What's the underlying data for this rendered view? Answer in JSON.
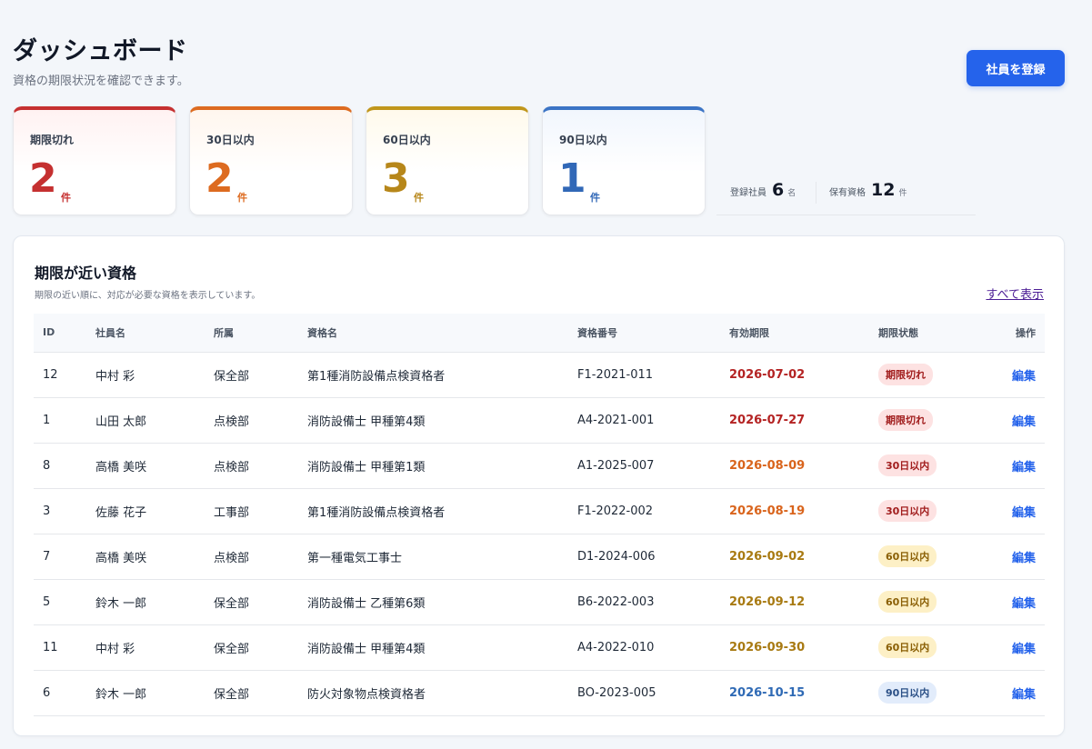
{
  "header": {
    "title": "ダッシュボード",
    "subtitle": "資格の期限状況を確認できます。",
    "register_button": "社員を登録"
  },
  "summary_cards": [
    {
      "label": "期限切れ",
      "value": "2",
      "unit": "件",
      "color": "#c53030"
    },
    {
      "label": "30日以内",
      "value": "2",
      "unit": "件",
      "color": "#dd6b20"
    },
    {
      "label": "60日以内",
      "value": "3",
      "unit": "件",
      "color": "#c0961b"
    },
    {
      "label": "90日以内",
      "value": "1",
      "unit": "件",
      "color": "#3b74c5"
    }
  ],
  "stats": {
    "employees": {
      "label": "登録社員",
      "value": "6",
      "unit": "名"
    },
    "qualifications": {
      "label": "保有資格",
      "value": "12",
      "unit": "件"
    }
  },
  "panel": {
    "title": "期限が近い資格",
    "description": "期限の近い順に、対応が必要な資格を表示しています。",
    "view_all": "すべて表示"
  },
  "table": {
    "columns": [
      "ID",
      "社員名",
      "所属",
      "資格名",
      "資格番号",
      "有効期限",
      "期限状態",
      "操作"
    ],
    "rows": [
      {
        "id": "12",
        "name": "中村 彩",
        "dept": "保全部",
        "qual": "第1種消防設備点検資格者",
        "number": "F1-2021-011",
        "expiry": "2026-07-02",
        "status": "期限切れ",
        "level": "expired",
        "action": "編集"
      },
      {
        "id": "1",
        "name": "山田 太郎",
        "dept": "点検部",
        "qual": "消防設備士 甲種第4類",
        "number": "A4-2021-001",
        "expiry": "2026-07-27",
        "status": "期限切れ",
        "level": "expired",
        "action": "編集"
      },
      {
        "id": "8",
        "name": "高橋 美咲",
        "dept": "点検部",
        "qual": "消防設備士 甲種第1類",
        "number": "A1-2025-007",
        "expiry": "2026-08-09",
        "status": "30日以内",
        "level": "30",
        "action": "編集"
      },
      {
        "id": "3",
        "name": "佐藤 花子",
        "dept": "工事部",
        "qual": "第1種消防設備点検資格者",
        "number": "F1-2022-002",
        "expiry": "2026-08-19",
        "status": "30日以内",
        "level": "30",
        "action": "編集"
      },
      {
        "id": "7",
        "name": "高橋 美咲",
        "dept": "点検部",
        "qual": "第一種電気工事士",
        "number": "D1-2024-006",
        "expiry": "2026-09-02",
        "status": "60日以内",
        "level": "60",
        "action": "編集"
      },
      {
        "id": "5",
        "name": "鈴木 一郎",
        "dept": "保全部",
        "qual": "消防設備士 乙種第6類",
        "number": "B6-2022-003",
        "expiry": "2026-09-12",
        "status": "60日以内",
        "level": "60",
        "action": "編集"
      },
      {
        "id": "11",
        "name": "中村 彩",
        "dept": "保全部",
        "qual": "消防設備士 甲種第4類",
        "number": "A4-2022-010",
        "expiry": "2026-09-30",
        "status": "60日以内",
        "level": "60",
        "action": "編集"
      },
      {
        "id": "6",
        "name": "鈴木 一郎",
        "dept": "保全部",
        "qual": "防火対象物点検資格者",
        "number": "BO-2023-005",
        "expiry": "2026-10-15",
        "status": "90日以内",
        "level": "90",
        "action": "編集"
      }
    ]
  }
}
